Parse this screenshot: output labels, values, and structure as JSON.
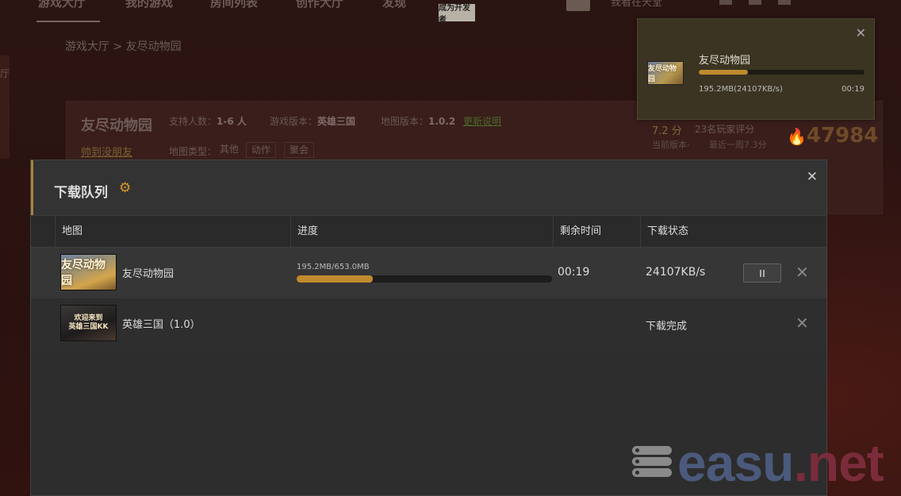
{
  "background": {
    "top_nav": [
      "游戏大厅",
      "我的游戏",
      "房间列表",
      "创作大厅",
      "发现"
    ],
    "dev_badge": "成为开发者",
    "username": "我看在天堂",
    "side_text": "厅",
    "breadcrumb": "游戏大厅 > 友尽动物园",
    "game": {
      "title": "友尽动物园",
      "players_label": "支持人数：",
      "players_value": "1-6 人",
      "game_version_label": "游戏版本：",
      "game_version_value": "英雄三国",
      "map_version_label": "地图版本：",
      "map_version_value": "1.0.2",
      "changelog_link": "更新说明",
      "help_link": "帅到没朋友",
      "type_label": "地图类型：",
      "tags": [
        "其他",
        "动作",
        "聚会"
      ],
      "rating": "7.2 分",
      "rating_count": "23名玩家评分",
      "current_version": "当前版本-",
      "week_score": "最近一周7.3分",
      "hot_value": "47984"
    }
  },
  "toast": {
    "title": "友尽动物园",
    "progress_fraction": 0.299,
    "size_speed": "195.2MB(24107KB/s)",
    "time_left": "00:19",
    "thumb_text": "友尽动物园"
  },
  "modal": {
    "title": "下载队列",
    "columns": [
      "地图",
      "进度",
      "剩余时间",
      "下载状态"
    ],
    "rows": [
      {
        "name": "友尽动物园",
        "thumb_text": "友尽动物园",
        "size": "195.2MB/653.0MB",
        "progress_fraction": 0.299,
        "time_left": "00:19",
        "speed": "24107KB/s"
      },
      {
        "name": "英雄三国（1.0）",
        "thumb_line1": "欢迎来到",
        "thumb_line2": "英雄三国KK",
        "status": "下载完成"
      }
    ]
  },
  "watermark": {
    "part1": "easu",
    "part2": ".net"
  },
  "colors": {
    "accent": "#c08a2e",
    "gear": "#d79a2a",
    "header_bar": "#a6843d"
  }
}
